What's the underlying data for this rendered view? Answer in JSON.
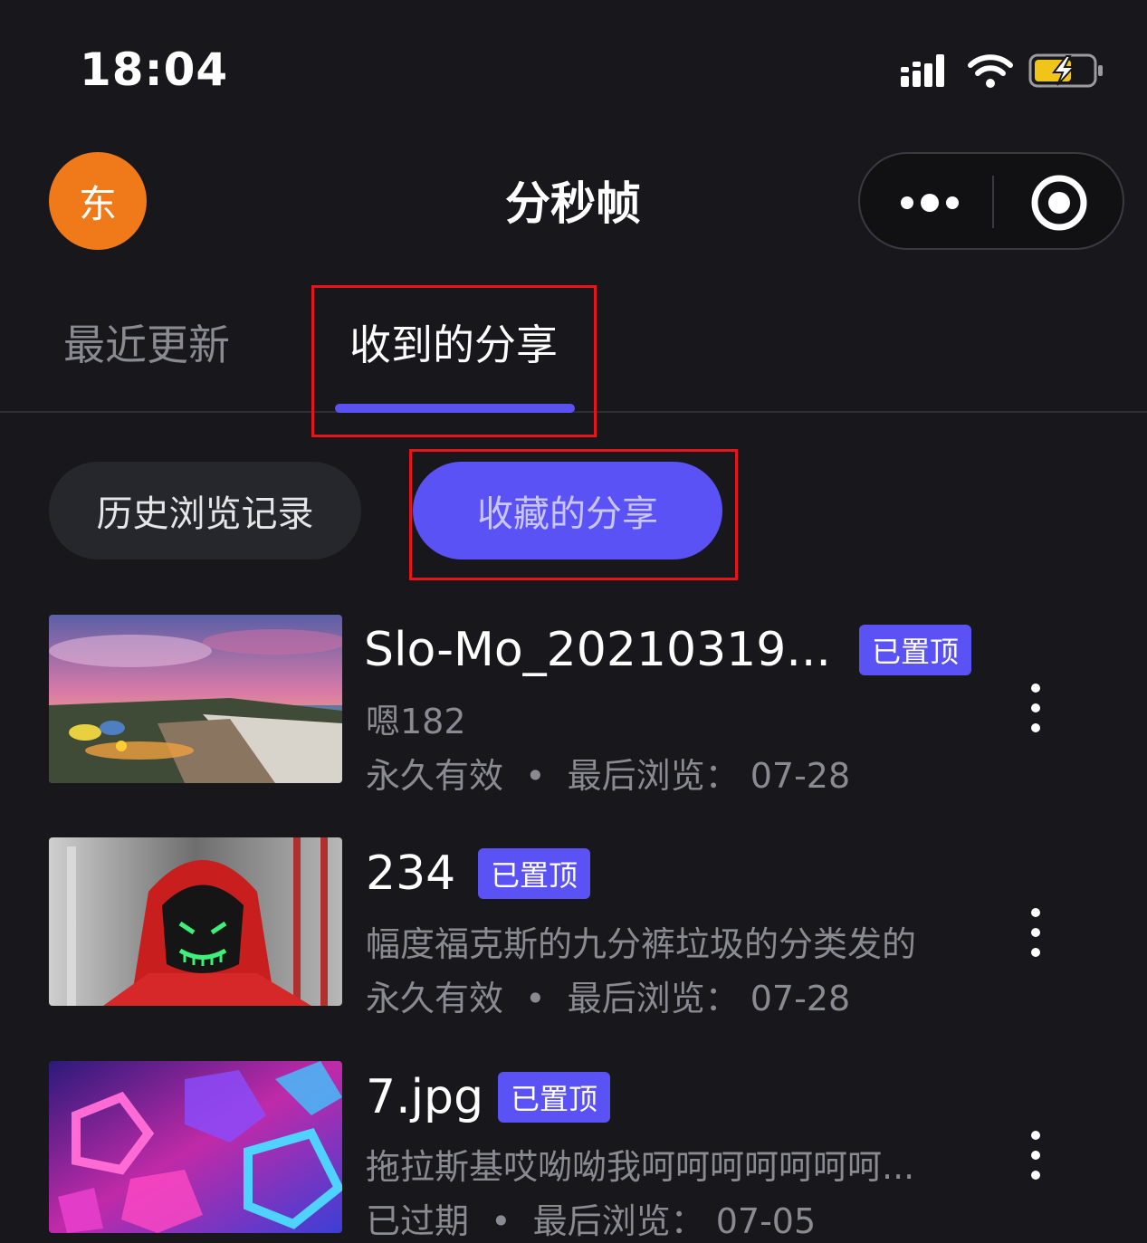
{
  "status_bar": {
    "time": "18:04"
  },
  "header": {
    "avatar_text": "东",
    "title": "分秒帧"
  },
  "tabs": [
    {
      "label": "最近更新"
    },
    {
      "label": "收到的分享"
    }
  ],
  "pills": {
    "history": "历史浏览记录",
    "favorites": "收藏的分享"
  },
  "items": [
    {
      "title": "Slo-Mo_20210319...",
      "badge": "已置顶",
      "description": "嗯182",
      "validity": "永久有效",
      "dot": "•",
      "last_viewed_label": "最后浏览：",
      "last_viewed_date": "07-28"
    },
    {
      "title": "234",
      "badge": "已置顶",
      "description": "幅度福克斯的九分裤垃圾的分类发的",
      "validity": "永久有效",
      "dot": "•",
      "last_viewed_label": "最后浏览：",
      "last_viewed_date": "07-28"
    },
    {
      "title": "7.jpg",
      "badge": "已置顶",
      "description": "拖拉斯基哎呦呦我呵呵呵呵呵呵呵...",
      "validity": "已过期",
      "dot": "•",
      "last_viewed_label": "最后浏览：",
      "last_viewed_date": "07-05"
    }
  ],
  "colors": {
    "accent": "#5b52f5",
    "avatar": "#f07a1a",
    "highlight": "#e8141c"
  }
}
